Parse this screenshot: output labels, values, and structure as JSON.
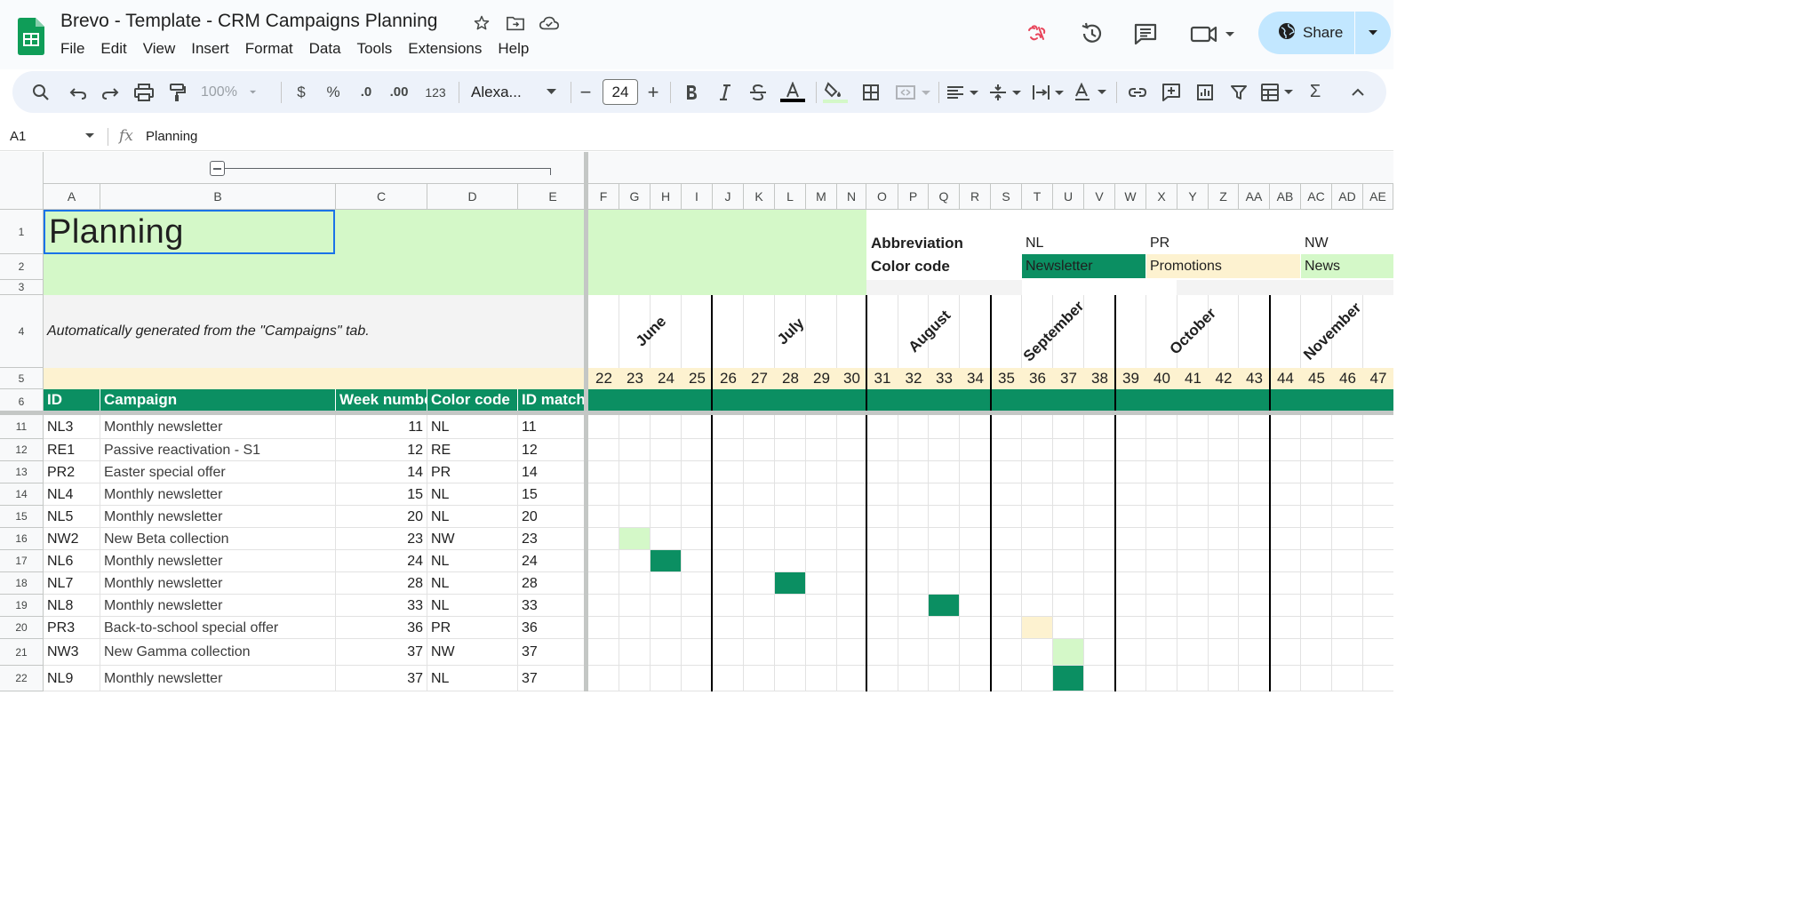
{
  "window": {
    "doc_title": "Brevo -  Template - CRM Campaigns Planning",
    "menu": [
      "File",
      "Edit",
      "View",
      "Insert",
      "Format",
      "Data",
      "Tools",
      "Extensions",
      "Help"
    ],
    "share_label": "Share"
  },
  "toolbar": {
    "zoom": "100%",
    "currency": "$",
    "percent": "%",
    "decrease_decimal": ".0",
    "increase_decimal": ".00",
    "number_format": "123",
    "font": "Alexa...",
    "font_size": "24",
    "minus": "−",
    "plus": "+"
  },
  "formula_bar": {
    "cell_ref": "A1",
    "fx": "fx",
    "content": "Planning"
  },
  "columns": [
    "A",
    "B",
    "C",
    "D",
    "E",
    "F",
    "G",
    "H",
    "I",
    "J",
    "K",
    "L",
    "M",
    "N",
    "O",
    "P",
    "Q",
    "R",
    "S",
    "T",
    "U",
    "V",
    "W",
    "X",
    "Y",
    "Z",
    "AA",
    "AB",
    "AC",
    "AD",
    "AE"
  ],
  "rows": [
    "1",
    "2",
    "3",
    "4",
    "5",
    "6",
    "11",
    "12",
    "13",
    "14",
    "15",
    "16",
    "17",
    "18",
    "19",
    "20",
    "21",
    "22"
  ],
  "sheet": {
    "title": "Planning",
    "subtitle": "Automatically generated from the \"Campaigns\" tab.",
    "legend": {
      "abbreviation_label": "Abbreviation",
      "color_code_label": "Color code",
      "items": [
        {
          "abbr": "NL",
          "name": "Newsletter",
          "color": "#0b8f62"
        },
        {
          "abbr": "PR",
          "name": "Promotions",
          "color": "#fdf2d0"
        },
        {
          "abbr": "NW",
          "name": "News",
          "color": "#d4f8c8"
        }
      ]
    },
    "months": [
      "June",
      "July",
      "August",
      "September",
      "October",
      "November"
    ],
    "weeks": [
      "22",
      "23",
      "24",
      "25",
      "26",
      "27",
      "28",
      "29",
      "30",
      "31",
      "32",
      "33",
      "34",
      "35",
      "36",
      "37",
      "38",
      "39",
      "40",
      "41",
      "42",
      "43",
      "44",
      "45",
      "46",
      "47"
    ],
    "table_headers": [
      "ID",
      "Campaign",
      "Week numbe",
      "Color code",
      "ID match"
    ],
    "campaigns": [
      {
        "id": "NL3",
        "campaign": "Monthly newsletter",
        "week": "11",
        "code": "NL",
        "match": "11"
      },
      {
        "id": "RE1",
        "campaign": "Passive reactivation - S1",
        "week": "12",
        "code": "RE",
        "match": "12"
      },
      {
        "id": "PR2",
        "campaign": "Easter special offer",
        "week": "14",
        "code": "PR",
        "match": "14"
      },
      {
        "id": "NL4",
        "campaign": "Monthly newsletter",
        "week": "15",
        "code": "NL",
        "match": "15"
      },
      {
        "id": "NL5",
        "campaign": "Monthly newsletter",
        "week": "20",
        "code": "NL",
        "match": "20"
      },
      {
        "id": "NW2",
        "campaign": "New Beta collection",
        "week": "23",
        "code": "NW",
        "match": "23"
      },
      {
        "id": "NL6",
        "campaign": "Monthly newsletter",
        "week": "24",
        "code": "NL",
        "match": "24"
      },
      {
        "id": "NL7",
        "campaign": "Monthly newsletter",
        "week": "28",
        "code": "NL",
        "match": "28"
      },
      {
        "id": "NL8",
        "campaign": "Monthly newsletter",
        "week": "33",
        "code": "NL",
        "match": "33"
      },
      {
        "id": "PR3",
        "campaign": "Back-to-school special offer",
        "week": "36",
        "code": "PR",
        "match": "36"
      },
      {
        "id": "NW3",
        "campaign": "New Gamma collection",
        "week": "37",
        "code": "NW",
        "match": "37"
      },
      {
        "id": "NL9",
        "campaign": "Monthly newsletter",
        "week": "37",
        "code": "NL",
        "match": "37"
      }
    ]
  },
  "colors": {
    "title_bg": "#d4f8c8",
    "header_green": "#0b8f62",
    "week_bg": "#fdf2d0",
    "subtitle_bg": "#f3f3f3",
    "promo": "#fdf2d0",
    "news": "#d4f8c8",
    "newsletter": "#0b8f62"
  }
}
